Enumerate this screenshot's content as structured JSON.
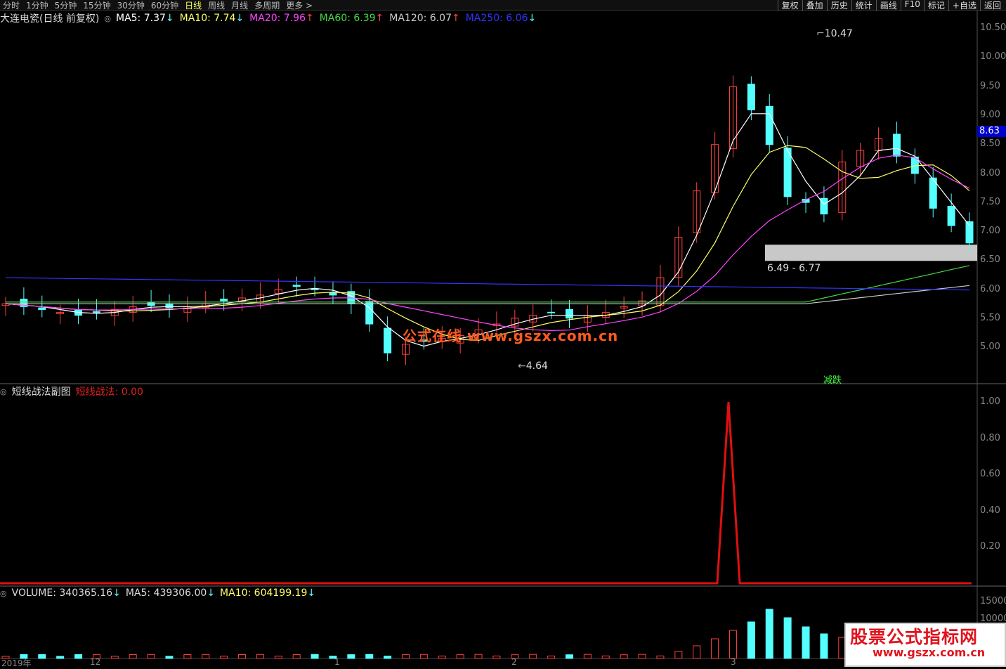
{
  "toolbar": {
    "tabs": [
      "分时",
      "1分钟",
      "5分钟",
      "15分钟",
      "30分钟",
      "60分钟",
      "日线",
      "周线",
      "月线",
      "多周期",
      "更多 >"
    ],
    "active_tab": "日线",
    "right_buttons": [
      "复权",
      "叠加",
      "历史",
      "统计",
      "画线",
      "F10",
      "标记",
      "+自选",
      "返回"
    ]
  },
  "main_panel": {
    "title": "大连电瓷(日线 前复权)",
    "indicators": [
      {
        "label": "MA5: 7.37",
        "dir": "↓",
        "color": "#ffffff"
      },
      {
        "label": "MA10: 7.74",
        "dir": "↓",
        "color": "#ffff66"
      },
      {
        "label": "MA20: 7.96",
        "dir": "↑",
        "color": "#ff44ff"
      },
      {
        "label": "MA60: 6.39",
        "dir": "↑",
        "color": "#44dd44"
      },
      {
        "label": "MA120: 6.07",
        "dir": "↑",
        "color": "#cccccc"
      },
      {
        "label": "MA250: 6.06",
        "dir": "↓",
        "color": "#3333ff"
      }
    ],
    "y_ticks": [
      "10.50",
      "10.00",
      "9.50",
      "9.00",
      "8.50",
      "8.00",
      "7.50",
      "7.00",
      "6.50",
      "6.00",
      "5.50",
      "5.00"
    ],
    "current_price": "8.63",
    "high_label": "10.47",
    "low_label": "4.64",
    "gap_label": "6.49 - 6.77",
    "event_label": "减跌",
    "watermark": "公式在线  www.gszx.com.cn"
  },
  "sub_panel": {
    "title": "短线战法副图",
    "indicator_label": "短线战法: 0.00",
    "y_ticks": [
      "1.00",
      "0.80",
      "0.60",
      "0.40",
      "0.20"
    ]
  },
  "volume_panel": {
    "label": "VOLUME: 340365.16",
    "ma5": "MA5: 439306.00",
    "ma10": "MA10: 604199.19",
    "y_ticks": [
      "15000",
      "10000"
    ]
  },
  "x_axis": {
    "labels": [
      "2019年",
      "12",
      "1",
      "2",
      "3"
    ]
  },
  "logo": {
    "line1": "股票公式指标网",
    "line2": "www.gszx.com.cn"
  },
  "chart_data": {
    "type": "line",
    "title": "大连电瓷(日线 前复权)",
    "ylim": [
      4.5,
      10.7
    ],
    "close_approx": [
      5.75,
      5.7,
      5.65,
      5.6,
      5.55,
      5.6,
      5.65,
      5.7,
      5.72,
      5.68,
      5.7,
      5.75,
      5.8,
      5.85,
      5.9,
      6.0,
      6.05,
      6.0,
      5.9,
      5.75,
      5.4,
      4.9,
      5.05,
      5.1,
      5.15,
      5.2,
      5.3,
      5.4,
      5.5,
      5.55,
      5.6,
      5.5,
      5.55,
      5.6,
      5.7,
      5.8,
      6.2,
      6.9,
      7.7,
      8.5,
      9.5,
      9.1,
      8.5,
      7.6,
      7.5,
      7.3,
      8.2,
      8.4,
      8.6,
      8.3,
      8.0,
      7.4,
      7.1,
      6.8
    ],
    "series": [
      {
        "name": "MA5",
        "last": 7.37
      },
      {
        "name": "MA10",
        "last": 7.74
      },
      {
        "name": "MA20",
        "last": 7.96
      },
      {
        "name": "MA60",
        "last": 6.39
      },
      {
        "name": "MA120",
        "last": 6.07
      },
      {
        "name": "MA250",
        "last": 6.06
      }
    ],
    "sub_indicator": {
      "name": "短线战法",
      "spike_value": 1.0,
      "baseline": 0.0
    }
  }
}
